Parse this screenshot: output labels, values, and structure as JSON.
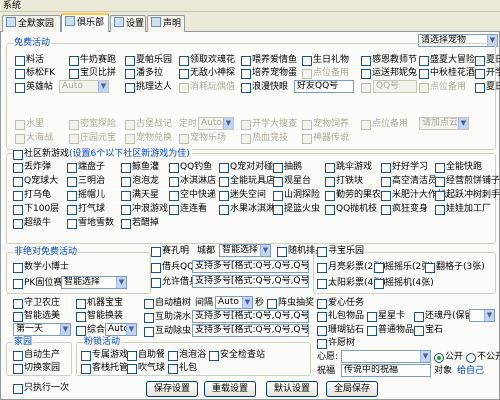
{
  "window": {
    "title": "系统"
  },
  "tabs": [
    {
      "label": "全默家园"
    },
    {
      "label": "俱乐部"
    },
    {
      "label": "设置"
    },
    {
      "label": "声明"
    }
  ],
  "pet_select": {
    "value": "请选择宠物"
  },
  "free": {
    "title": "免费活动",
    "row1": [
      "料活",
      "牛奶赛跑",
      "夏帕乐园",
      "领取欢魂花",
      "喂养爱情鱼",
      "生日礼物",
      "感恩教师节",
      "盛夏大冒险",
      "夏日春豹"
    ],
    "row2": [
      "标松FK",
      "宝贝比拼",
      "潘多拉",
      "无敌小神探",
      "培养宠物蛋",
      "点位备用",
      "运送邦妮兔",
      "中秋桂花酒",
      "开学活动"
    ],
    "row3": {
      "name": "英雄帖",
      "combo": "Auto",
      "items": [
        "挑理达人",
        "消耗玩偶值",
        "浪漫快眼",
        "环魔礼服日",
        "点位备用",
        "夏日冰爽"
      ],
      "qq_label": "QQ号",
      "qq2_label": "QQ号",
      "qq_placeholder": "好友QQ号"
    },
    "row4": [
      "水里",
      "密室探险",
      "古堡战记",
      "定时",
      "Auto",
      "开学大搜查",
      "宠物饲养",
      "点位备用",
      "请加点云"
    ],
    "row5": [
      "大海战",
      "庄园元宝",
      "宠物兑换",
      "宠物乐场",
      "热血竞技",
      "神器传说"
    ]
  },
  "community": {
    "title": "社区新游戏",
    "hint": "(设置6个以下社区新游戏为佳)",
    "cols": [
      [
        "丢炸弹",
        "Q宠球大",
        "打乌龟",
        "下100层",
        "超级牛"
      ],
      [
        "端盘子",
        "三明治",
        "摇帽儿",
        "打气球",
        "雪地雪数"
      ],
      [
        "鲸鱼灌",
        "泡泡龙",
        "满天星",
        "冲浪游戏",
        "若醋掉"
      ],
      [
        "QQ钓鱼",
        "冰淇淋店",
        "空中快递",
        "连连看",
        ""
      ],
      [
        "Q宠对对碰",
        "全能玩具店",
        "迷失空间",
        "水果冰淇淋",
        ""
      ],
      [
        "抽鹅",
        "观星台",
        "山洞探险",
        "提篮火虫",
        ""
      ],
      [
        "跳伞游戏",
        "打铁块",
        "勤劳的果农",
        "QQ抛机枝",
        ""
      ],
      [
        "好好学习",
        "高空清洁员",
        "米肥汁大作战",
        "疯狂变身",
        ""
      ],
      [
        "全能快跑",
        "经营煎饼铺子",
        "起跃冲树刺手",
        "娃娃加工厂",
        ""
      ]
    ]
  },
  "non_free": {
    "title": "非绝对免费活动",
    "combo_label": "数学小博士",
    "flag": "PK固位赛",
    "flag_combo": "智能选择"
  },
  "shark": {
    "label": "赛孔明",
    "speed_label": "城都",
    "combo": "智能选择",
    "add": "随机排兵",
    "hint1": "支持多号[格式:Q号,Q号,Q号,]",
    "hint2": "支持多号[格式:Q号,Q号,Q号,]",
    "hint3": "支持多号[格式:Q号,Q号,Q号,]",
    "items": [
      "借兵QQ号",
      "允许借兵"
    ]
  },
  "pet_treasure": {
    "title": "寻宝乐园",
    "items": [
      "月亮彩票(2张)",
      "摇摇乐(2张)",
      "翻格子(3张)",
      "太阳彩票(4张)",
      "摇摇机(4张)"
    ]
  },
  "farm": {
    "items": [
      "守卫农庄",
      "智能选美",
      "第一天"
    ],
    "robot": [
      "机器宝宝",
      "智能换装",
      "综合",
      "Auto"
    ],
    "auto": [
      "自动植树",
      "间隔",
      "Auto",
      "秒",
      "阵虫抽奖",
      "互助浇水",
      "互动除虫"
    ],
    "qq_hint": "支持多号[格式:Q号,Q号,Q号,]"
  },
  "love": {
    "title": "爱心任务",
    "items": [
      "礼包物品",
      "星星卡",
      "还魂丹(保留",
      "颜料",
      "珊瑚钻石",
      "普通物品",
      "宝石"
    ]
  },
  "home": {
    "title": "家园",
    "items": [
      "自动生产",
      "切换家园"
    ]
  },
  "fan": {
    "title": "粉锁活动",
    "items": [
      "专属游戏",
      "自助餐",
      "泡泡浴",
      "安全检查站",
      "客栈托管",
      "吹气球",
      "礼包"
    ]
  },
  "wish": {
    "title": "许愿树",
    "heart_label": "心愿:",
    "options": [
      "公开",
      "不公开"
    ],
    "wish_label": "祝福",
    "wish_value": "传说中的祝福",
    "target_label": "对象",
    "target_value": "给自己"
  },
  "footer": {
    "once": "只执行一次",
    "buttons": [
      "保存设置",
      "重载设置",
      "默认设置",
      "全局保存"
    ]
  }
}
